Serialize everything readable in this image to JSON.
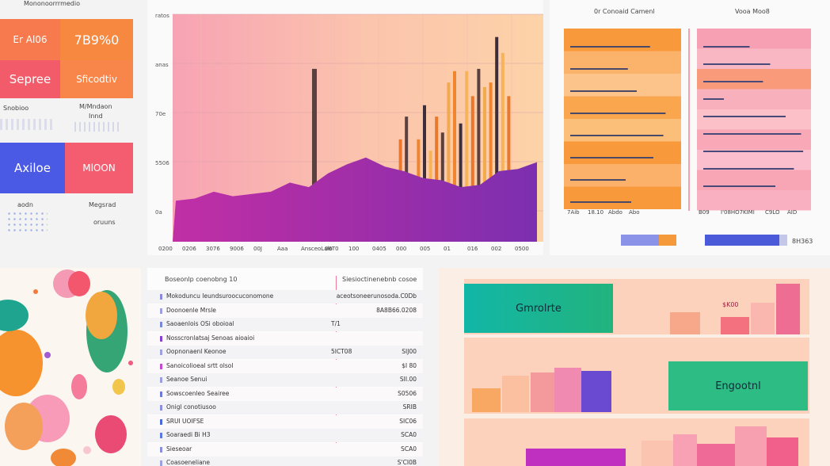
{
  "left_panel": {
    "header": "Mononoorrrmedio",
    "tiles": [
      {
        "label": "Er Al06",
        "color": "#f77a4f"
      },
      {
        "label": "7B9%0",
        "color": "#f7883f"
      },
      {
        "label": "Sepree",
        "color": "#f25c6a"
      },
      {
        "label": "Sficodtiv",
        "color": "#f8854a"
      },
      {
        "label": "Axiloe",
        "color": "#4b5ae4"
      },
      {
        "label": "MlOON",
        "color": "#f45d6f"
      }
    ],
    "notes": [
      "Snobioo",
      "M/Mndaon",
      "Innd",
      "aodn",
      "Megsrad",
      "oruuns"
    ]
  },
  "main_chart": {
    "y_ticks": [
      "ratos",
      "anas",
      "70e",
      "5506",
      "0a"
    ],
    "x_ticks": [
      "0200",
      "0206",
      "3076",
      "9006",
      "00J",
      "Aaa",
      "AnsceoLalo",
      "06T0",
      "100",
      "0405",
      "000",
      "005",
      "01",
      "016",
      "002",
      "0500"
    ]
  },
  "chart_data": [
    {
      "type": "bar",
      "title": "",
      "xlabel": "",
      "ylabel": "",
      "ylim": [
        0,
        100
      ],
      "series": [
        {
          "values": [
            4,
            10,
            8,
            12,
            76,
            16,
            10,
            17,
            20,
            45,
            55,
            28,
            45,
            60,
            40,
            55,
            48,
            70,
            75,
            52,
            75,
            64,
            76,
            68,
            70,
            90,
            83,
            64
          ]
        }
      ],
      "area": [
        18,
        19,
        22,
        20,
        21,
        22,
        26,
        24,
        30,
        34,
        37,
        33,
        31,
        28,
        27,
        24,
        25,
        31,
        32,
        35
      ]
    },
    {
      "type": "bar",
      "title": "0r Conoaid Camenl",
      "values": [
        72,
        52,
        60,
        86,
        84,
        75,
        50,
        55
      ],
      "xlabel": "",
      "tick_labels": [
        "7Aib",
        "18.10",
        "Abdo",
        "Abo"
      ]
    },
    {
      "type": "bar",
      "title": "Vooa Moo8",
      "values": [
        45,
        65,
        58,
        20,
        80,
        95,
        97,
        88,
        70
      ],
      "tick_labels": [
        "B09 ",
        "I'08HO7",
        "KIMI",
        "C9LO",
        "AID"
      ]
    }
  ],
  "right_top": {
    "legend_values": [
      "8H363"
    ],
    "legend_colors": [
      "#8a93e8",
      "#f59a3a",
      "#4a5ad8"
    ]
  },
  "table": {
    "header_left": "Boseonlp coenobng 10",
    "header_right": "Siesioctinenebnb cosoe",
    "rows": [
      {
        "label": "Mokoduncu Ieundsuroocuconomone",
        "value": "",
        "right": "aceotsoneerunosoda.C0Db",
        "mark": "#8a8adc"
      },
      {
        "label": "Doonoenle Mrsle",
        "value": "",
        "right": "8A8B66.0208",
        "mark": "#9aa0e0"
      },
      {
        "label": "Saoaenlois OSi oboioal",
        "value": "T/1",
        "right": "",
        "mark": "#7a88d8"
      },
      {
        "label": "Nosscronlatsaj Senoas aioaioi",
        "value": "",
        "right": "",
        "mark": "#8a3fd0"
      },
      {
        "label": "Oopnonaenl Keonoe",
        "value": "5ICT08",
        "right": "SIJ00",
        "mark": "#9aa0e0"
      },
      {
        "label": "Sanoicolioeal srtt olsol",
        "value": "",
        "right": "$I 80",
        "mark": "#c24bd0"
      },
      {
        "label": "Seanoe Senui",
        "value": "",
        "right": "SII.00",
        "mark": "#9a9fe0"
      },
      {
        "label": "Sowscoenleo Seairee",
        "value": "",
        "right": "S0506",
        "mark": "#6f7bd8"
      },
      {
        "label": "Onigl conotiusoo",
        "value": "",
        "right": "SRIB",
        "mark": "#8a90e0"
      },
      {
        "label": "SRUI UOIFSE",
        "value": "",
        "right": "SIC06",
        "mark": "#4a6ad8"
      },
      {
        "label": "Soaraedi Bi H3",
        "value": "",
        "right": "SCA0",
        "mark": "#5a7ae0"
      },
      {
        "label": "Sieseoar",
        "value": "",
        "right": "SCA0",
        "mark": "#8a90e0"
      },
      {
        "label": "Coasoeneliane",
        "value": "",
        "right": "S'CI0B",
        "mark": "#9aa0e0"
      }
    ]
  },
  "bottom_right": {
    "card1": "Gmrolrte",
    "card2": "Engootnl",
    "price": "$K00"
  }
}
